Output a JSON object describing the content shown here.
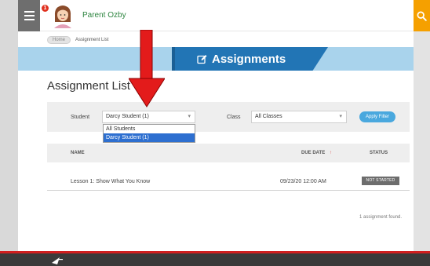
{
  "header": {
    "notification_count": "1",
    "user_name": "Parent Ozby"
  },
  "breadcrumb": {
    "home": "Home",
    "current": "Assignment List"
  },
  "banner": {
    "title": "Assignments"
  },
  "page": {
    "title": "Assignment List"
  },
  "filters": {
    "student_label": "Student",
    "student_value": "Darcy Student (1)",
    "class_label": "Class",
    "class_value": "All Classes",
    "apply_label": "Apply Filter",
    "student_options": [
      "All Students",
      "Darcy Student (1)"
    ]
  },
  "table": {
    "columns": {
      "name": "NAME",
      "due_date": "DUE DATE",
      "sort_indicator": "↑",
      "status": "STATUS"
    },
    "rows": [
      {
        "name": "Lesson 1: Show What You Know",
        "due_date": "09/23/20 12:00 AM",
        "status": "NOT STARTED"
      }
    ]
  },
  "result_count": "1 assignment found.",
  "colors": {
    "accent_blue": "#2275b5",
    "banner_light_blue": "#a9d3ec",
    "search_orange": "#f5a000",
    "badge_red": "#e0301e",
    "arrow_red": "#e31b1b",
    "footer_red": "#d01f1f",
    "selected_option": "#2d6fd0"
  }
}
